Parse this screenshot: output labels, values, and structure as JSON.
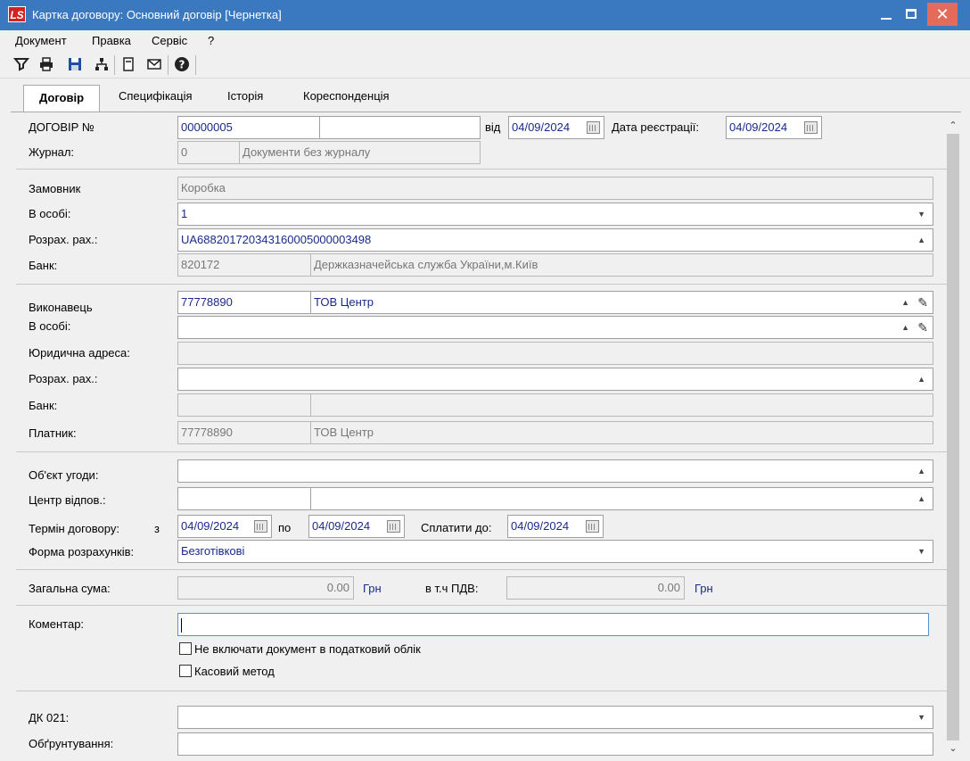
{
  "window": {
    "logo": "LS",
    "title": "Картка договору: Основний договір [Чернетка]"
  },
  "menu": [
    "Документ",
    "Правка",
    "Сервіс",
    "?"
  ],
  "toolbar": [
    "filter-icon",
    "print-icon",
    "save-icon",
    "tree-icon",
    "form-icon",
    "mail-icon",
    "help-icon"
  ],
  "tabs": [
    "Договір",
    "Специфікація",
    "Історія",
    "Кореспонденція"
  ],
  "form": {
    "contract_no_label": "ДОГОВІР №",
    "contract_no": "00000005",
    "contract_no_extra": "",
    "from_label": "від",
    "from_date": "04/09/2024",
    "reg_date_label": "Дата реєстрації:",
    "reg_date": "04/09/2024",
    "journal_label": "Журнал:",
    "journal_code": "0",
    "journal_name": "Документи без журналу",
    "customer_label": "Замовник",
    "customer": "Коробка",
    "customer_person_label": "В особі:",
    "customer_person": "1",
    "customer_account_label": "Розрах. рах.:",
    "customer_account": "UA688201720343160005000003498",
    "customer_bank_label": "Банк:",
    "customer_bank_code": "820172",
    "customer_bank_name": "Держказначейська служба України,м.Київ",
    "executor_label": "Виконавець",
    "executor_code": "77778890",
    "executor_name": "ТОВ Центр",
    "executor_person_label": "В особі:",
    "executor_person": "",
    "legal_address_label": "Юридична адреса:",
    "legal_address": "",
    "executor_account_label": "Розрах. рах.:",
    "executor_account": "",
    "executor_bank_label": "Банк:",
    "executor_bank_code": "",
    "executor_bank_name": "",
    "payer_label": "Платник:",
    "payer_code": "77778890",
    "payer_name": "ТОВ Центр",
    "subject_label": "Об'єкт угоди:",
    "subject": "",
    "resp_center_label": "Центр відпов.:",
    "resp_center_code": "",
    "resp_center_name": "",
    "term_label": "Термін договору:",
    "term_from_label": "з",
    "term_from": "04/09/2024",
    "term_to_label": "по",
    "term_to": "04/09/2024",
    "pay_until_label": "Сплатити до:",
    "pay_until": "04/09/2024",
    "payment_form_label": "Форма розрахунків:",
    "payment_form": "Безготівкові",
    "total_label": "Загальна сума:",
    "total": "0.00",
    "total_currency": "Грн",
    "vat_label": "в т.ч ПДВ:",
    "vat": "0.00",
    "vat_currency": "Грн",
    "comment_label": "Коментар:",
    "comment": "",
    "no_tax_label": "Не включати документ в податковий облік",
    "cash_method_label": "Касовий метод",
    "dk021_label": "ДК 021:",
    "dk021": "",
    "justification_label": "Обґрунтування:",
    "justification": ""
  }
}
